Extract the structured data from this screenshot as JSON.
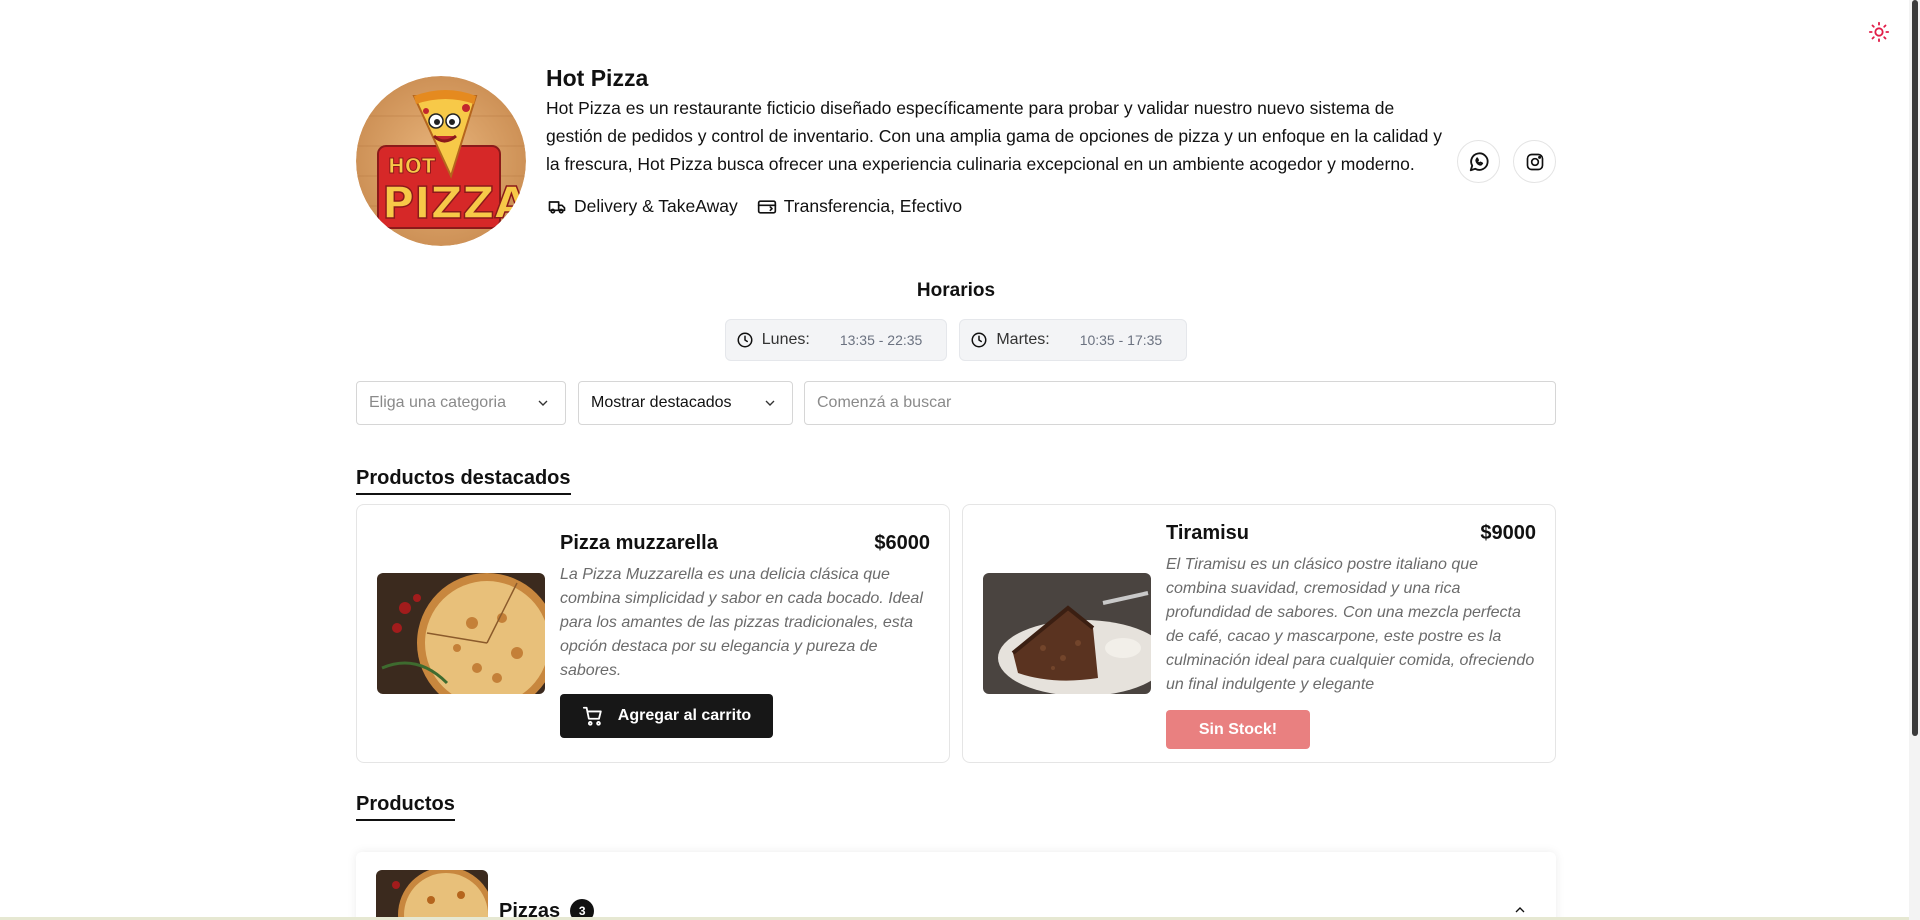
{
  "colors": {
    "accent": "#e11d48",
    "button_dark": "#171717",
    "no_stock": "#e98080",
    "chip_bg": "#f3f4f6"
  },
  "theme_toggle": {
    "icon": "sun-icon"
  },
  "restaurant": {
    "name": "Hot Pizza",
    "description": "Hot Pizza es un restaurante ficticio diseñado específicamente para probar y validar nuestro nuevo sistema de gestión de pedidos y control de inventario. Con una amplia gama de opciones de pizza y un enfoque en la calidad y la frescura, Hot Pizza busca ofrecer una experiencia culinaria excepcional en un ambiente acogedor y moderno.",
    "logo_text_top": "HOT",
    "logo_text_bottom": "PIZZA",
    "delivery_label": "Delivery & TakeAway",
    "payment_label": "Transferencia, Efectivo",
    "social": {
      "whatsapp_icon": "whatsapp-icon",
      "instagram_icon": "instagram-icon"
    }
  },
  "horarios": {
    "title": "Horarios",
    "days": [
      {
        "day": "Lunes:",
        "time": "13:35 - 22:35"
      },
      {
        "day": "Martes:",
        "time": "10:35 - 17:35"
      }
    ]
  },
  "filters": {
    "category_placeholder": "Eliga una categoria",
    "featured_value": "Mostrar destacados",
    "search_placeholder": "Comenzá a buscar"
  },
  "featured": {
    "title": "Productos destacados",
    "products": [
      {
        "name": "Pizza muzzarella",
        "price": "$6000",
        "description": "La Pizza Muzzarella es una delicia clásica que combina simplicidad y sabor en cada bocado. Ideal para los amantes de las pizzas tradicionales, esta opción destaca por su elegancia y pureza de sabores.",
        "button": "Agregar al carrito"
      },
      {
        "name": "Tiramisu",
        "price": "$9000",
        "description": "El Tiramisu es un clásico postre italiano que combina suavidad, cremosidad y una rica profundidad de sabores. Con una mezcla perfecta de café, cacao y mascarpone, este postre es la culminación ideal para cualquier comida, ofreciendo un final indulgente y elegante",
        "button": "Sin Stock!"
      }
    ]
  },
  "products": {
    "title": "Productos",
    "categories": [
      {
        "name": "Pizzas",
        "count": "3"
      }
    ]
  }
}
